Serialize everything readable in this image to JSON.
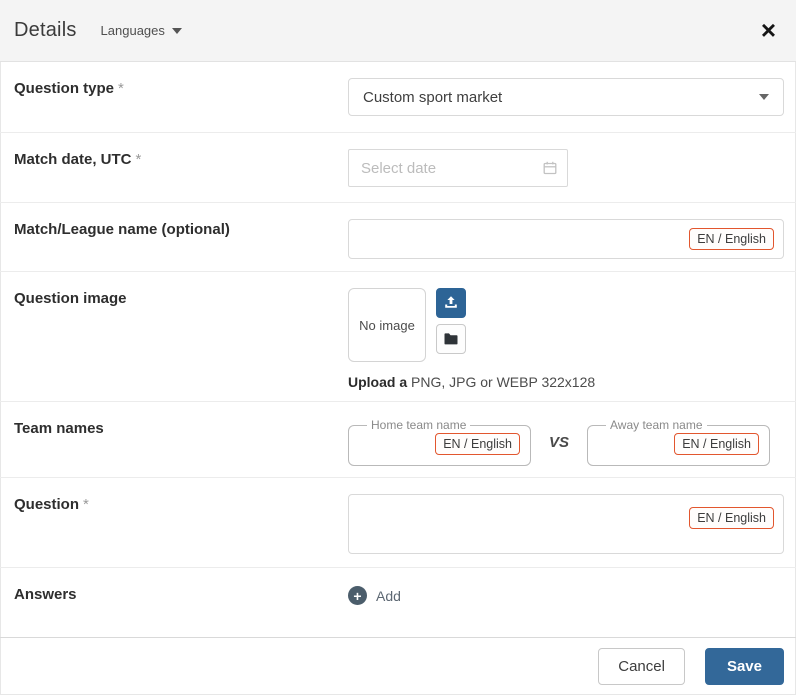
{
  "header": {
    "title": "Details",
    "languages_label": "Languages",
    "close_icon": "×"
  },
  "form": {
    "required_mark": "*",
    "question_type": {
      "label": "Question type",
      "value": "Custom sport market"
    },
    "match_date": {
      "label": "Match date, UTC",
      "placeholder": "Select date"
    },
    "league_name": {
      "label": "Match/League name (optional)",
      "lang_badge": "EN / English"
    },
    "question_image": {
      "label": "Question image",
      "empty_text": "No image",
      "hint_bold": "Upload a",
      "hint_rest": " PNG, JPG or WEBP 322x128"
    },
    "team_names": {
      "label": "Team names",
      "home_label": "Home team name",
      "away_label": "Away team name",
      "vs": "VS",
      "home_badge": "EN / English",
      "away_badge": "EN / English"
    },
    "question": {
      "label": "Question",
      "lang_badge": "EN / English"
    },
    "answers": {
      "label": "Answers",
      "add_icon": "+",
      "add_label": "Add"
    }
  },
  "footer": {
    "cancel_label": "Cancel",
    "save_label": "Save"
  },
  "colors": {
    "accent_blue": "#336899",
    "badge_orange": "#e2562e",
    "header_bg": "#f4f4f4",
    "add_circle": "#4b5d6b"
  }
}
